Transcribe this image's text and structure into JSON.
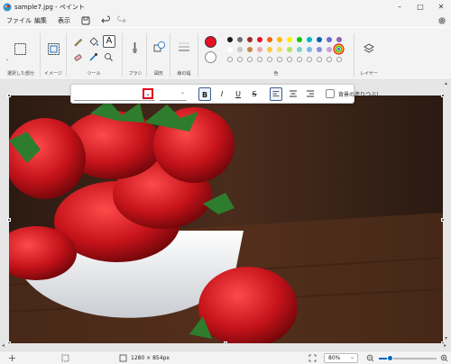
{
  "window": {
    "title": "sample7.jpg - ペイント"
  },
  "menu": {
    "file": "ファイル",
    "edit": "編集",
    "view": "表示"
  },
  "ribbon": {
    "selection_label": "選択した部分",
    "image_label": "イメージ",
    "tools_label": "ツール",
    "brushes_label": "ブラシ",
    "shapes_label": "図形",
    "size_label": "線の幅",
    "colors_label": "色",
    "layers_label": "レイヤー",
    "active_color": "#e81123",
    "palette_row1": [
      "#1b1b1b",
      "#6e6e6e",
      "#9c2a2a",
      "#e81123",
      "#f7630c",
      "#ffb900",
      "#fff100",
      "#16c60c",
      "#00b7c3",
      "#0063b1",
      "#6b69d6",
      "#8764b8"
    ],
    "palette_row2": [
      "#ffffff",
      "#c8c8c8",
      "#c6894e",
      "#f4a6b0",
      "#ffc83d",
      "#f7dc6f",
      "#b4e36a",
      "#7fd1c7",
      "#7ab9e8",
      "#8a8fd6",
      "#c4a1e0"
    ],
    "palette_empty_count": 12
  },
  "text_toolbar": {
    "font_value": "",
    "size_value": "",
    "bold": "B",
    "italic": "I",
    "underline": "U",
    "strike": "S",
    "fill_label": "背景の塗りつぶし"
  },
  "status": {
    "dimensions": "1280 × 854px",
    "zoom": "80%",
    "zoom_fraction": 0.2
  }
}
